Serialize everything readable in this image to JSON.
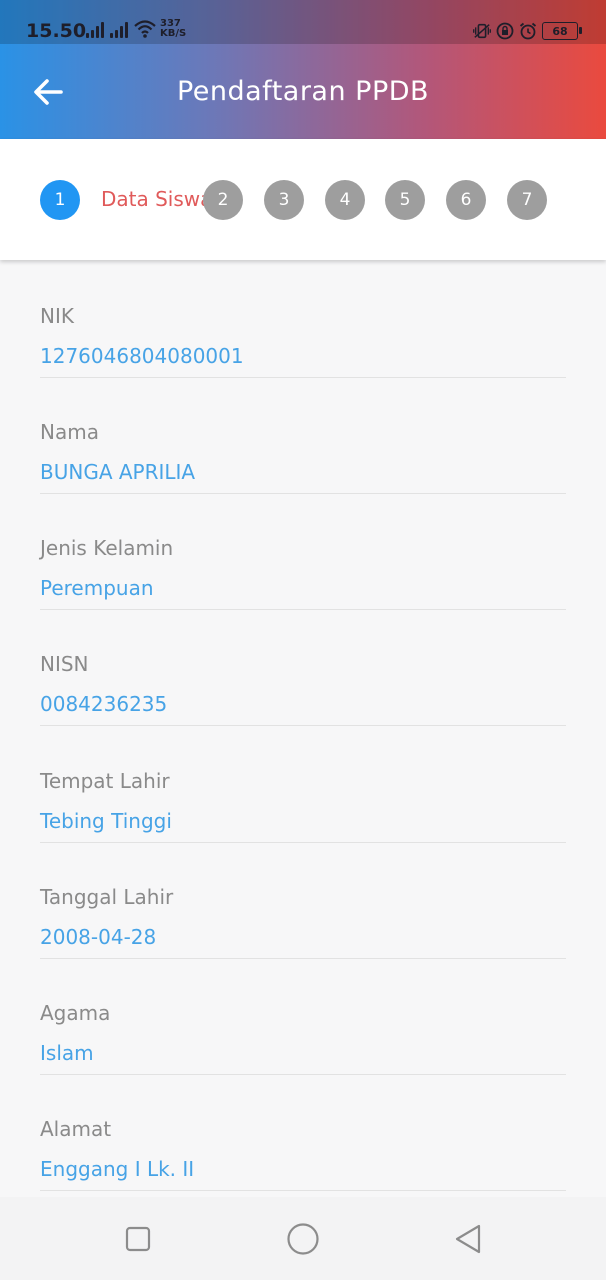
{
  "status_bar": {
    "time": "15.50",
    "net_speed_value": "337",
    "net_speed_unit": "KB/S",
    "battery": "68",
    "icons": [
      "signal-icon",
      "signal-icon",
      "wifi-icon",
      "vibrate-icon",
      "lock-rotation-icon",
      "alarm-icon",
      "battery-icon"
    ]
  },
  "app_bar": {
    "title": "Pendaftaran PPDB",
    "back_icon": "arrow-left-icon"
  },
  "stepper": {
    "active_label": "Data Siswa",
    "steps": [
      "1",
      "2",
      "3",
      "4",
      "5",
      "6",
      "7"
    ],
    "active_step": "1",
    "active_color": "#2196f3",
    "inactive_color": "#9e9e9e",
    "label_color": "#e05a5a"
  },
  "fields": [
    {
      "label": "NIK",
      "value": "1276046804080001"
    },
    {
      "label": "Nama",
      "value": "BUNGA APRILIA"
    },
    {
      "label": "Jenis Kelamin",
      "value": "Perempuan"
    },
    {
      "label": "NISN",
      "value": "0084236235"
    },
    {
      "label": "Tempat Lahir",
      "value": "Tebing Tinggi"
    },
    {
      "label": "Tanggal Lahir",
      "value": "2008-04-28"
    },
    {
      "label": "Agama",
      "value": "Islam"
    },
    {
      "label": "Alamat",
      "value": "Enggang I Lk. II"
    }
  ],
  "nav_bar": {
    "buttons": [
      "recents-icon",
      "home-icon",
      "back-triangle-icon"
    ]
  },
  "colors": {
    "header_gradient": [
      "#2a92e6",
      "#6c78b8",
      "#b2577a",
      "#ea4a3e"
    ],
    "value_text": "#47a3e6",
    "label_text": "#8a8a8a"
  }
}
